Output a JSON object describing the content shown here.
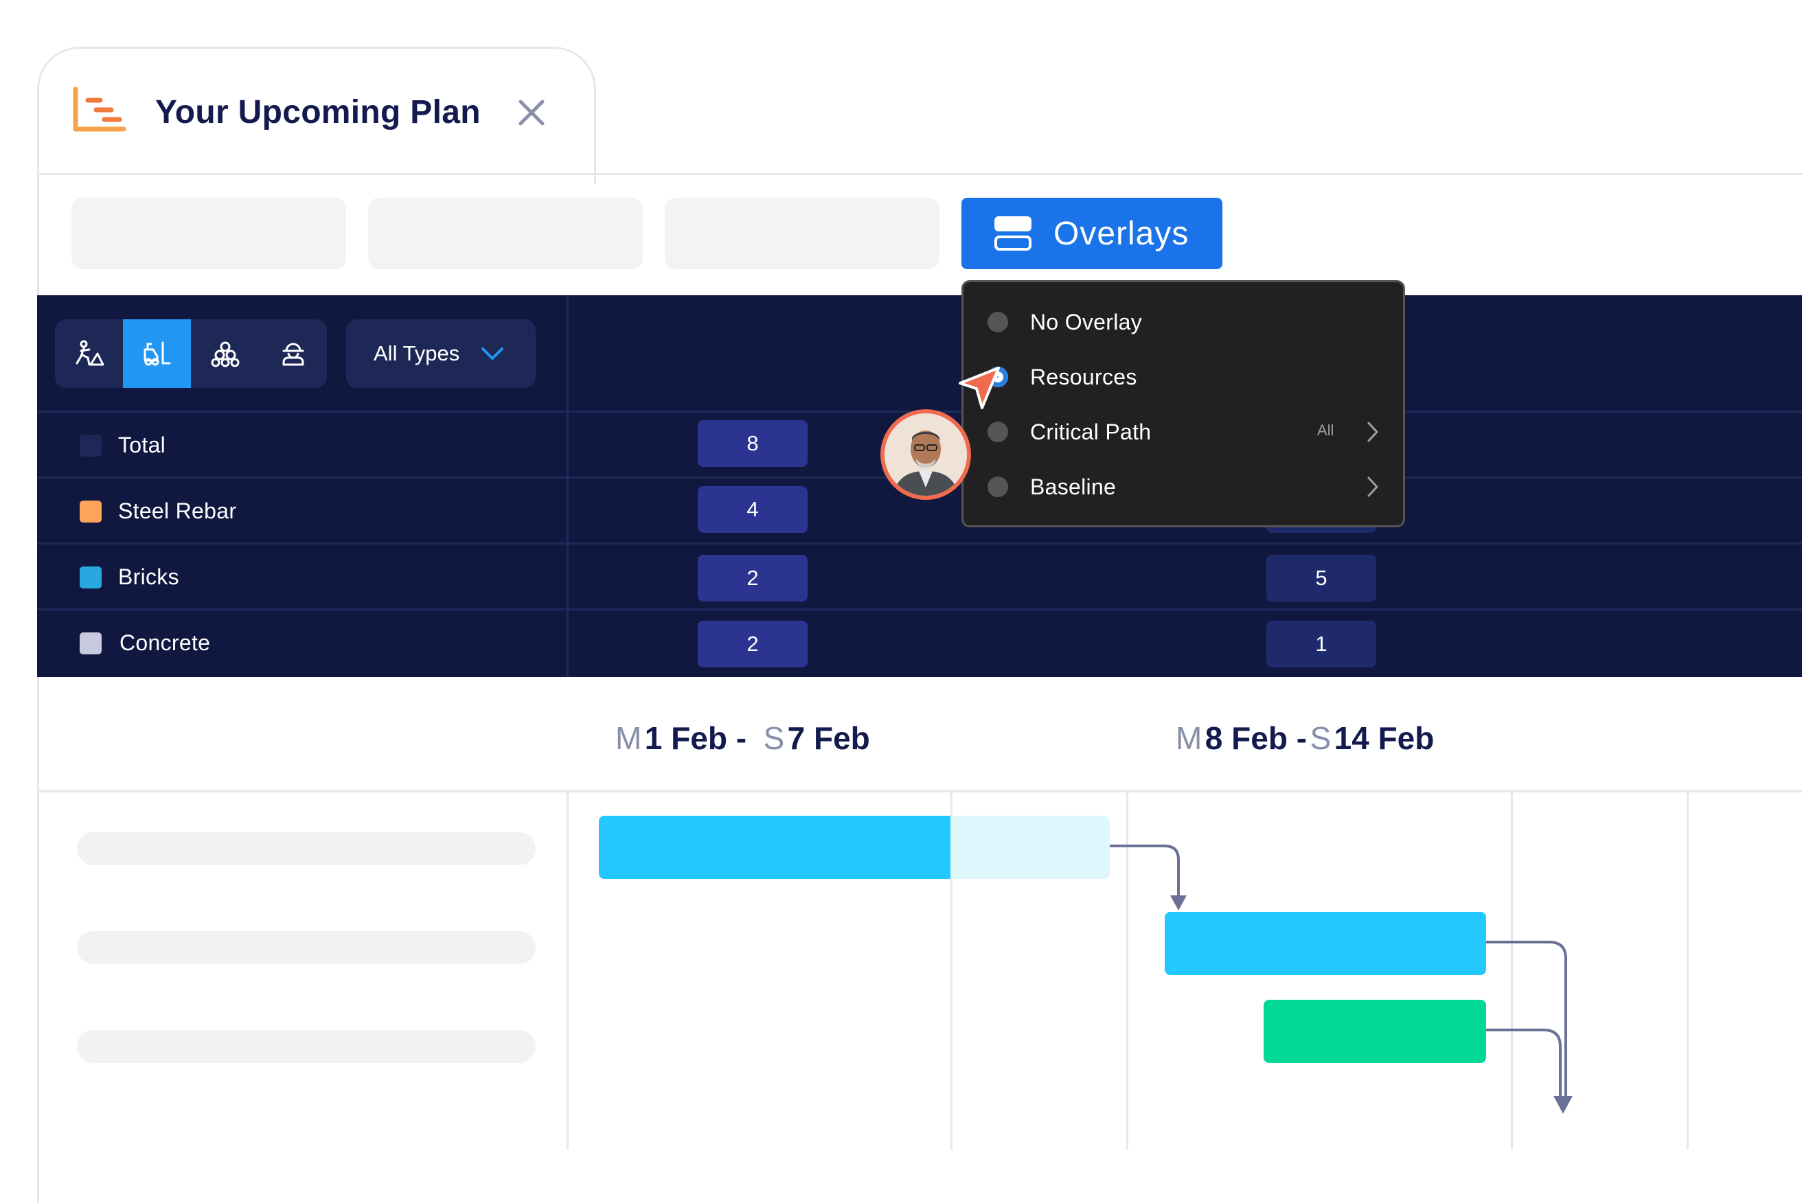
{
  "tab": {
    "title": "Your Upcoming Plan"
  },
  "toolbar": {
    "overlays_label": "Overlays"
  },
  "filters": {
    "types_label": "All Types",
    "icons": [
      "worker-icon",
      "forklift-icon",
      "materials-icon",
      "operator-icon"
    ],
    "active_index": 1
  },
  "resources": [
    {
      "name": "Total",
      "color": "#1e2856",
      "week1": "8",
      "week2": ""
    },
    {
      "name": "Steel Rebar",
      "color": "#ffa55a",
      "week1": "4",
      "week2": ""
    },
    {
      "name": "Bricks",
      "color": "#29a8e0",
      "week1": "2",
      "week2": "5"
    },
    {
      "name": "Concrete",
      "color": "#c8cbe0",
      "week1": "2",
      "week2": "1"
    }
  ],
  "menu": {
    "items": [
      {
        "label": "No Overlay"
      },
      {
        "label": "Resources"
      },
      {
        "label": "Critical Path",
        "suffix": "All"
      },
      {
        "label": "Baseline"
      }
    ],
    "selected": "Resources"
  },
  "dates": {
    "week1": {
      "start_day": "M",
      "start": "1 Feb -",
      "end_day": "S",
      "end": "7 Feb"
    },
    "week2": {
      "start_day": "M",
      "start": "8 Feb -",
      "end_day": "S",
      "end": "14 Feb"
    }
  },
  "colors": {
    "accent": "#1a73e8",
    "panel": "#10183f",
    "bar_blue": "#24c8ff",
    "bar_blue_light": "#e0f6fd",
    "bar_green": "#00d896",
    "cursor": "#f06a4d"
  }
}
